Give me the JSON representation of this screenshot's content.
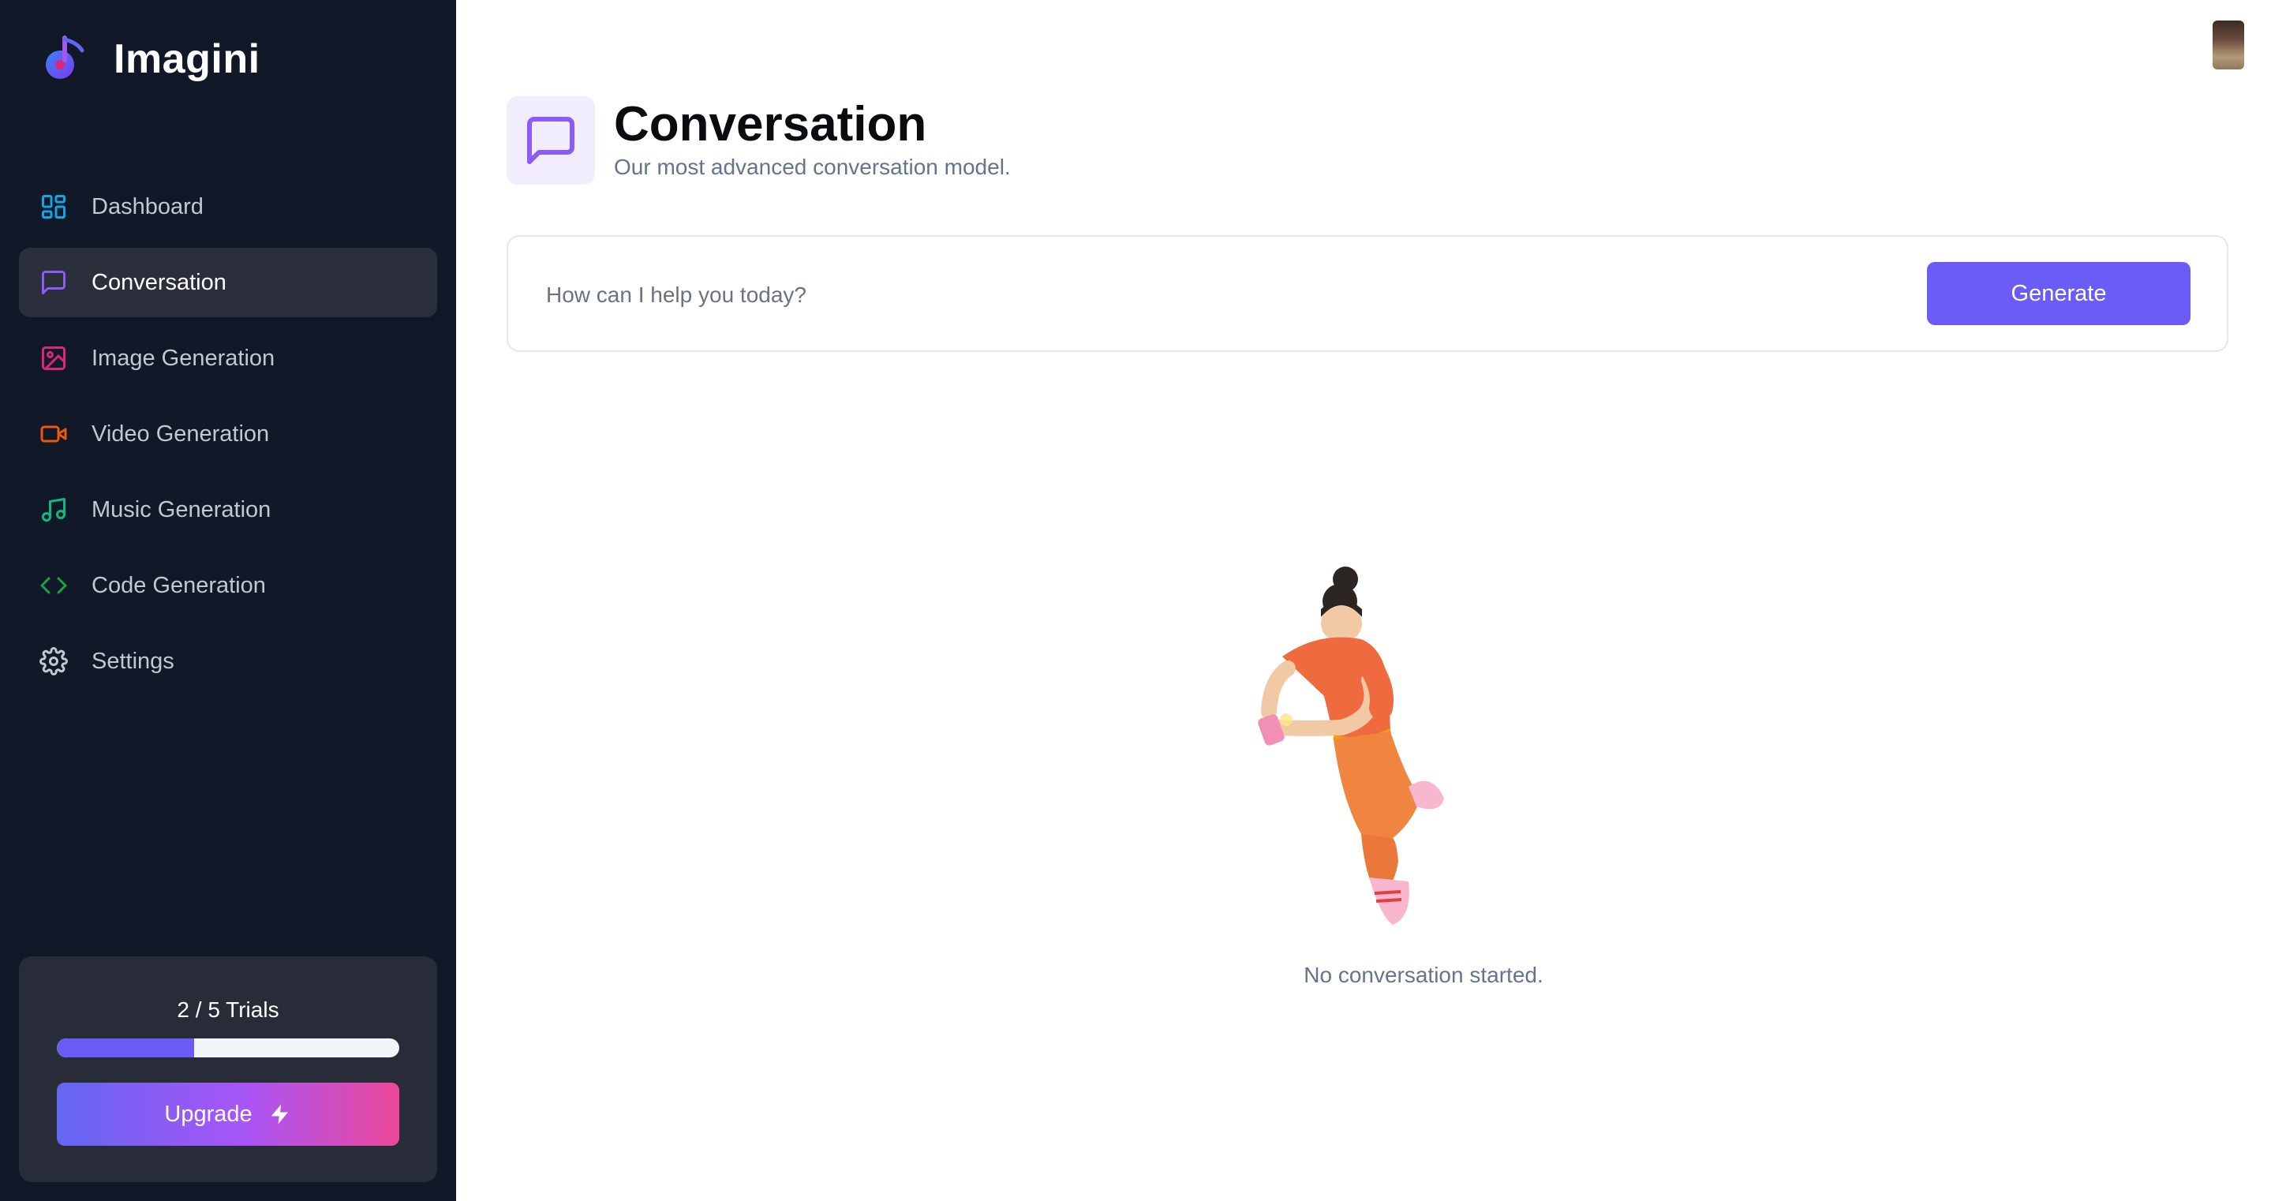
{
  "brand": {
    "name": "Imagini"
  },
  "sidebar": {
    "items": [
      {
        "label": "Dashboard",
        "icon": "dashboard-icon",
        "color": "#0ea5e9",
        "active": false
      },
      {
        "label": "Conversation",
        "icon": "chat-bubble-icon",
        "color": "#8b5cf6",
        "active": true
      },
      {
        "label": "Image Generation",
        "icon": "image-icon",
        "color": "#db2777",
        "active": false
      },
      {
        "label": "Video Generation",
        "icon": "video-icon",
        "color": "#ea580c",
        "active": false
      },
      {
        "label": "Music Generation",
        "icon": "music-note-icon",
        "color": "#10b981",
        "active": false
      },
      {
        "label": "Code Generation",
        "icon": "code-icon",
        "color": "#16a34a",
        "active": false
      },
      {
        "label": "Settings",
        "icon": "gear-icon",
        "color": "#c3c7cf",
        "active": false
      }
    ],
    "trials": {
      "text": "2 / 5 Trials",
      "used": 2,
      "total": 5
    },
    "upgrade_label": "Upgrade"
  },
  "header": {
    "title": "Conversation",
    "subtitle": "Our most advanced conversation model.",
    "icon": "chat-bubble-icon",
    "accent": "#8b5cf6"
  },
  "prompt": {
    "placeholder": "How can I help you today?",
    "value": "",
    "generate_label": "Generate"
  },
  "empty_state": {
    "text": "No conversation started."
  },
  "colors": {
    "primary": "#6b5cf5",
    "sidebar_bg": "#111827"
  }
}
